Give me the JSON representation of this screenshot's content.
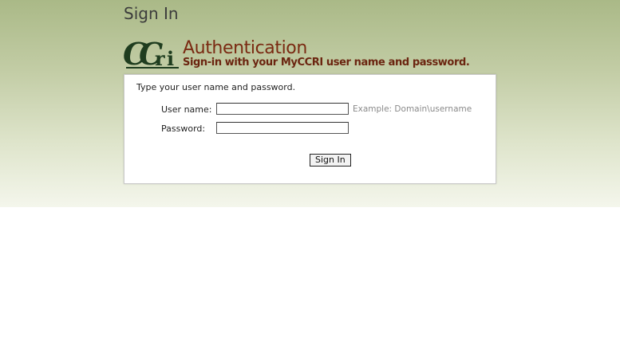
{
  "page": {
    "title": "Sign In"
  },
  "brand": {
    "logo_icon": "ccri-logo-icon",
    "logo_text": "CCRI",
    "logo_color": "#1f3d1f",
    "accent_color": "#7a2a12"
  },
  "header": {
    "heading": "Authentication",
    "subheading": "Sign-in with your MyCCRI user name and password."
  },
  "form": {
    "instruction": "Type your user name and password.",
    "username_label": "User name:",
    "username_value": "",
    "username_hint": "Example: Domain\\username",
    "password_label": "Password:",
    "password_value": "",
    "submit_label": "Sign In"
  }
}
